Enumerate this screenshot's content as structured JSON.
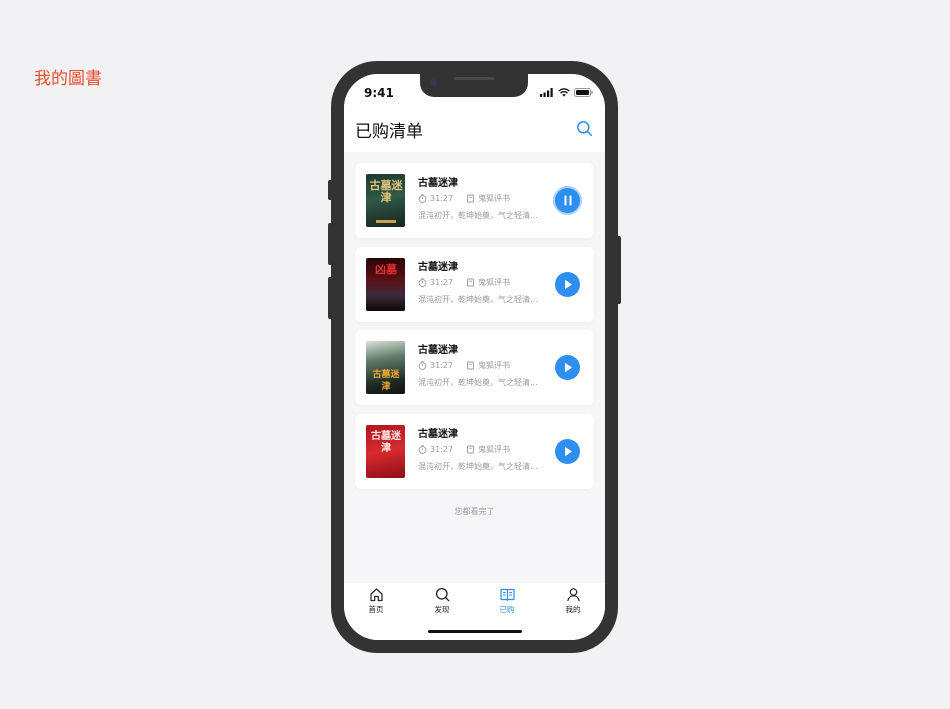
{
  "page_label": "我的圖書",
  "status_bar": {
    "time": "9:41"
  },
  "header": {
    "title": "已购清单"
  },
  "books": [
    {
      "title": "古墓迷津",
      "duration": "31:27",
      "author": "鬼狐评书",
      "description": "混沌初开，乾坤始奠，气之轻清...",
      "cover_text": "古墓迷津",
      "state": "playing"
    },
    {
      "title": "古墓迷津",
      "duration": "31:27",
      "author": "鬼狐评书",
      "description": "混沌初开，乾坤始奠，气之轻清...",
      "cover_text": "凶墓",
      "state": "paused"
    },
    {
      "title": "古墓迷津",
      "duration": "31:27",
      "author": "鬼狐评书",
      "description": "混沌初开，乾坤始奠，气之轻清...",
      "cover_text": "古墓迷津",
      "state": "paused"
    },
    {
      "title": "古墓迷津",
      "duration": "31:27",
      "author": "鬼狐评书",
      "description": "混沌初开，乾坤始奠，气之轻清...",
      "cover_text": "古墓迷津",
      "state": "paused"
    }
  ],
  "list_end_text": "您都看完了",
  "tabbar": {
    "items": [
      {
        "label": "首页",
        "icon": "home-icon"
      },
      {
        "label": "发现",
        "icon": "search-icon"
      },
      {
        "label": "已购",
        "icon": "book-icon",
        "active": true
      },
      {
        "label": "我的",
        "icon": "user-icon"
      }
    ]
  },
  "colors": {
    "accent": "#2f8ff0",
    "page_label": "#e8502f",
    "phone_frame": "#333333"
  }
}
